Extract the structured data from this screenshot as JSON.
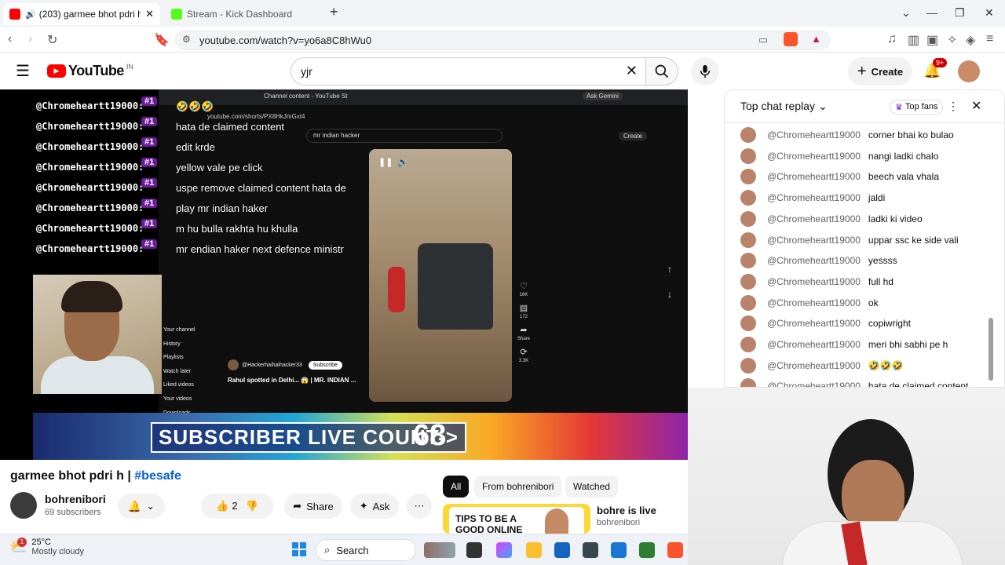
{
  "browser": {
    "tabs": [
      {
        "title": "(203) garmee bhot pdri h | #b",
        "active": true
      },
      {
        "title": "Stream - Kick Dashboard",
        "active": false
      }
    ],
    "url": "youtube.com/watch?v=yo6a8C8hWu0",
    "brave_shield_count": "76"
  },
  "youtube": {
    "logo_text": "YouTube",
    "region": "IN",
    "search_value": "yjr",
    "create_label": "Create",
    "notif_count": "9+"
  },
  "stream_overlay": {
    "chat_author": "@Chromeheartt19000:",
    "rank": "#1",
    "messages": [
      "🤣🤣🤣",
      "hata de claimed content",
      "edit krde",
      "yellow vale pe click",
      "uspe remove claimed content hata de",
      "play mr indian haker",
      "m hu bulla rakhta hu khulla",
      "mr endian haker next defence ministr"
    ],
    "inner_url": "youtube.com/shorts/PX8HkJmGxt4",
    "inner_search": "mr indian hacker",
    "inner_ask": "Ask Gemini",
    "inner_create": "Create",
    "inner_channel": "@Hackerhaihaihacker33",
    "inner_subscribe": "Subscribe",
    "inner_video_title": "Rahul spotted in Delhi... 😱 | MR. INDIAN ...",
    "inner_likes": "16K",
    "inner_comments": "172",
    "inner_share": "Share",
    "inner_remix": "3.3K",
    "inner_sidebar": [
      "Your channel",
      "History",
      "Playlists",
      "Watch later",
      "Liked videos",
      "Your videos",
      "Downloads"
    ],
    "sub_label": "SUBSCRIBER LIVE COUNT->",
    "sub_count": "68"
  },
  "chat_panel": {
    "title": "Top chat replay",
    "top_fans": "Top fans",
    "rows": [
      {
        "author": "@Chromeheartt19000",
        "msg": "corner bhai ko bulao"
      },
      {
        "author": "@Chromeheartt19000",
        "msg": "nangi ladki chalo"
      },
      {
        "author": "@Chromeheartt19000",
        "msg": "beech vala vhala"
      },
      {
        "author": "@Chromeheartt19000",
        "msg": "jaldi"
      },
      {
        "author": "@Chromeheartt19000",
        "msg": "ladki ki video"
      },
      {
        "author": "@Chromeheartt19000",
        "msg": "uppar ssc ke side vali"
      },
      {
        "author": "@Chromeheartt19000",
        "msg": "yessss"
      },
      {
        "author": "@Chromeheartt19000",
        "msg": "full hd"
      },
      {
        "author": "@Chromeheartt19000",
        "msg": "ok"
      },
      {
        "author": "@Chromeheartt19000",
        "msg": "copiwright"
      },
      {
        "author": "@Chromeheartt19000",
        "msg": "meri bhi sabhi pe h"
      },
      {
        "author": "@Chromeheartt19000",
        "msg": "🤣🤣🤣"
      },
      {
        "author": "@Chromeheartt19000",
        "msg": "hata de claimed content"
      }
    ]
  },
  "video_info": {
    "title": "garmee bhot pdri h | ",
    "hashtag": "#besafe",
    "channel": "bohrenibori",
    "subscribers": "69 subscribers",
    "likes": "2",
    "share": "Share",
    "ask": "Ask"
  },
  "filters": [
    "All",
    "From bohrenibori",
    "Watched"
  ],
  "recommendation": {
    "thumb_text": "TIPS TO BE A GOOD ONLINE",
    "title": "bohre is live",
    "channel": "bohrenibori"
  },
  "taskbar": {
    "weather_temp": "25°C",
    "weather_desc": "Mostly cloudy",
    "weather_badge": "1",
    "search_label": "Search"
  },
  "colors": {
    "yt_red": "#ff0000",
    "link_blue": "#065fd4",
    "rank_purple": "#6a1b9a"
  }
}
